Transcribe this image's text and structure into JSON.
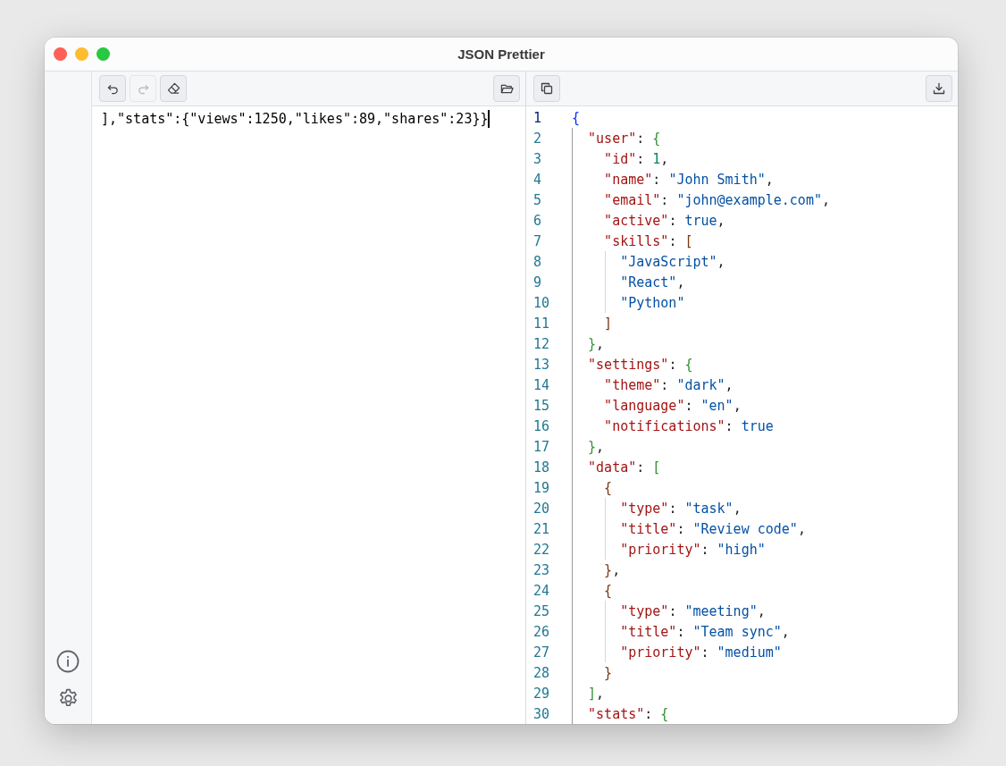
{
  "window": {
    "title": "JSON Prettier"
  },
  "sidebar": {
    "buttons": [
      {
        "kind": "info"
      },
      {
        "kind": "settings"
      }
    ]
  },
  "input_pane": {
    "toolbar": [
      {
        "kind": "undo",
        "disabled": false
      },
      {
        "kind": "redo",
        "disabled": true
      },
      {
        "kind": "clear",
        "disabled": false
      }
    ],
    "open_button": {
      "kind": "open"
    },
    "text": "],\"stats\":{\"views\":1250,\"likes\":89,\"shares\":23}}"
  },
  "output_pane": {
    "toolbar": [
      {
        "kind": "copy",
        "disabled": false
      }
    ],
    "download_button": {
      "kind": "download"
    },
    "lines": [
      {
        "number": "1",
        "active": true,
        "tokens": [
          {
            "kind": "bracket",
            "text": "{"
          }
        ]
      },
      {
        "number": "2",
        "active": false,
        "tokens": [
          {
            "kind": "key",
            "text": "  \"user\""
          },
          {
            "kind": "punct",
            "text": ": "
          },
          {
            "kind": "bracket",
            "text": "{"
          }
        ]
      },
      {
        "number": "3",
        "active": false,
        "tokens": [
          {
            "kind": "key",
            "text": "    \"id\""
          },
          {
            "kind": "punct",
            "text": ": "
          },
          {
            "kind": "number",
            "text": "1"
          },
          {
            "kind": "punct",
            "text": ","
          }
        ]
      },
      {
        "number": "4",
        "active": false,
        "tokens": [
          {
            "kind": "key",
            "text": "    \"name\""
          },
          {
            "kind": "punct",
            "text": ": "
          },
          {
            "kind": "string",
            "text": "\"John Smith\""
          },
          {
            "kind": "punct",
            "text": ","
          }
        ]
      },
      {
        "number": "5",
        "active": false,
        "tokens": [
          {
            "kind": "key",
            "text": "    \"email\""
          },
          {
            "kind": "punct",
            "text": ": "
          },
          {
            "kind": "string",
            "text": "\"john@example.com\""
          },
          {
            "kind": "punct",
            "text": ","
          }
        ]
      },
      {
        "number": "6",
        "active": false,
        "tokens": [
          {
            "kind": "key",
            "text": "    \"active\""
          },
          {
            "kind": "punct",
            "text": ": "
          },
          {
            "kind": "boolean",
            "text": "true"
          },
          {
            "kind": "punct",
            "text": ","
          }
        ]
      },
      {
        "number": "7",
        "active": false,
        "tokens": [
          {
            "kind": "key",
            "text": "    \"skills\""
          },
          {
            "kind": "punct",
            "text": ": "
          },
          {
            "kind": "bracket",
            "text": "["
          }
        ]
      },
      {
        "number": "8",
        "active": false,
        "tokens": [
          {
            "kind": "string",
            "text": "      \"JavaScript\""
          },
          {
            "kind": "punct",
            "text": ","
          }
        ]
      },
      {
        "number": "9",
        "active": false,
        "tokens": [
          {
            "kind": "string",
            "text": "      \"React\""
          },
          {
            "kind": "punct",
            "text": ","
          }
        ]
      },
      {
        "number": "10",
        "active": false,
        "tokens": [
          {
            "kind": "string",
            "text": "      \"Python\""
          }
        ]
      },
      {
        "number": "11",
        "active": false,
        "tokens": [
          {
            "kind": "bracket",
            "text": "    ]"
          }
        ]
      },
      {
        "number": "12",
        "active": false,
        "tokens": [
          {
            "kind": "bracket",
            "text": "  }"
          },
          {
            "kind": "punct",
            "text": ","
          }
        ]
      },
      {
        "number": "13",
        "active": false,
        "tokens": [
          {
            "kind": "key",
            "text": "  \"settings\""
          },
          {
            "kind": "punct",
            "text": ": "
          },
          {
            "kind": "bracket",
            "text": "{"
          }
        ]
      },
      {
        "number": "14",
        "active": false,
        "tokens": [
          {
            "kind": "key",
            "text": "    \"theme\""
          },
          {
            "kind": "punct",
            "text": ": "
          },
          {
            "kind": "string",
            "text": "\"dark\""
          },
          {
            "kind": "punct",
            "text": ","
          }
        ]
      },
      {
        "number": "15",
        "active": false,
        "tokens": [
          {
            "kind": "key",
            "text": "    \"language\""
          },
          {
            "kind": "punct",
            "text": ": "
          },
          {
            "kind": "string",
            "text": "\"en\""
          },
          {
            "kind": "punct",
            "text": ","
          }
        ]
      },
      {
        "number": "16",
        "active": false,
        "tokens": [
          {
            "kind": "key",
            "text": "    \"notifications\""
          },
          {
            "kind": "punct",
            "text": ": "
          },
          {
            "kind": "boolean",
            "text": "true"
          }
        ]
      },
      {
        "number": "17",
        "active": false,
        "tokens": [
          {
            "kind": "bracket",
            "text": "  }"
          },
          {
            "kind": "punct",
            "text": ","
          }
        ]
      },
      {
        "number": "18",
        "active": false,
        "tokens": [
          {
            "kind": "key",
            "text": "  \"data\""
          },
          {
            "kind": "punct",
            "text": ": "
          },
          {
            "kind": "bracket",
            "text": "["
          }
        ]
      },
      {
        "number": "19",
        "active": false,
        "tokens": [
          {
            "kind": "bracket",
            "text": "    {"
          }
        ]
      },
      {
        "number": "20",
        "active": false,
        "tokens": [
          {
            "kind": "key",
            "text": "      \"type\""
          },
          {
            "kind": "punct",
            "text": ": "
          },
          {
            "kind": "string",
            "text": "\"task\""
          },
          {
            "kind": "punct",
            "text": ","
          }
        ]
      },
      {
        "number": "21",
        "active": false,
        "tokens": [
          {
            "kind": "key",
            "text": "      \"title\""
          },
          {
            "kind": "punct",
            "text": ": "
          },
          {
            "kind": "string",
            "text": "\"Review code\""
          },
          {
            "kind": "punct",
            "text": ","
          }
        ]
      },
      {
        "number": "22",
        "active": false,
        "tokens": [
          {
            "kind": "key",
            "text": "      \"priority\""
          },
          {
            "kind": "punct",
            "text": ": "
          },
          {
            "kind": "string",
            "text": "\"high\""
          }
        ]
      },
      {
        "number": "23",
        "active": false,
        "tokens": [
          {
            "kind": "bracket",
            "text": "    }"
          },
          {
            "kind": "punct",
            "text": ","
          }
        ]
      },
      {
        "number": "24",
        "active": false,
        "tokens": [
          {
            "kind": "bracket",
            "text": "    {"
          }
        ]
      },
      {
        "number": "25",
        "active": false,
        "tokens": [
          {
            "kind": "key",
            "text": "      \"type\""
          },
          {
            "kind": "punct",
            "text": ": "
          },
          {
            "kind": "string",
            "text": "\"meeting\""
          },
          {
            "kind": "punct",
            "text": ","
          }
        ]
      },
      {
        "number": "26",
        "active": false,
        "tokens": [
          {
            "kind": "key",
            "text": "      \"title\""
          },
          {
            "kind": "punct",
            "text": ": "
          },
          {
            "kind": "string",
            "text": "\"Team sync\""
          },
          {
            "kind": "punct",
            "text": ","
          }
        ]
      },
      {
        "number": "27",
        "active": false,
        "tokens": [
          {
            "kind": "key",
            "text": "      \"priority\""
          },
          {
            "kind": "punct",
            "text": ": "
          },
          {
            "kind": "string",
            "text": "\"medium\""
          }
        ]
      },
      {
        "number": "28",
        "active": false,
        "tokens": [
          {
            "kind": "bracket",
            "text": "    }"
          }
        ]
      },
      {
        "number": "29",
        "active": false,
        "tokens": [
          {
            "kind": "bracket",
            "text": "  ]"
          },
          {
            "kind": "punct",
            "text": ","
          }
        ]
      },
      {
        "number": "30",
        "active": false,
        "tokens": [
          {
            "kind": "key",
            "text": "  \"stats\""
          },
          {
            "kind": "punct",
            "text": ": "
          },
          {
            "kind": "bracket",
            "text": "{"
          }
        ]
      }
    ]
  }
}
